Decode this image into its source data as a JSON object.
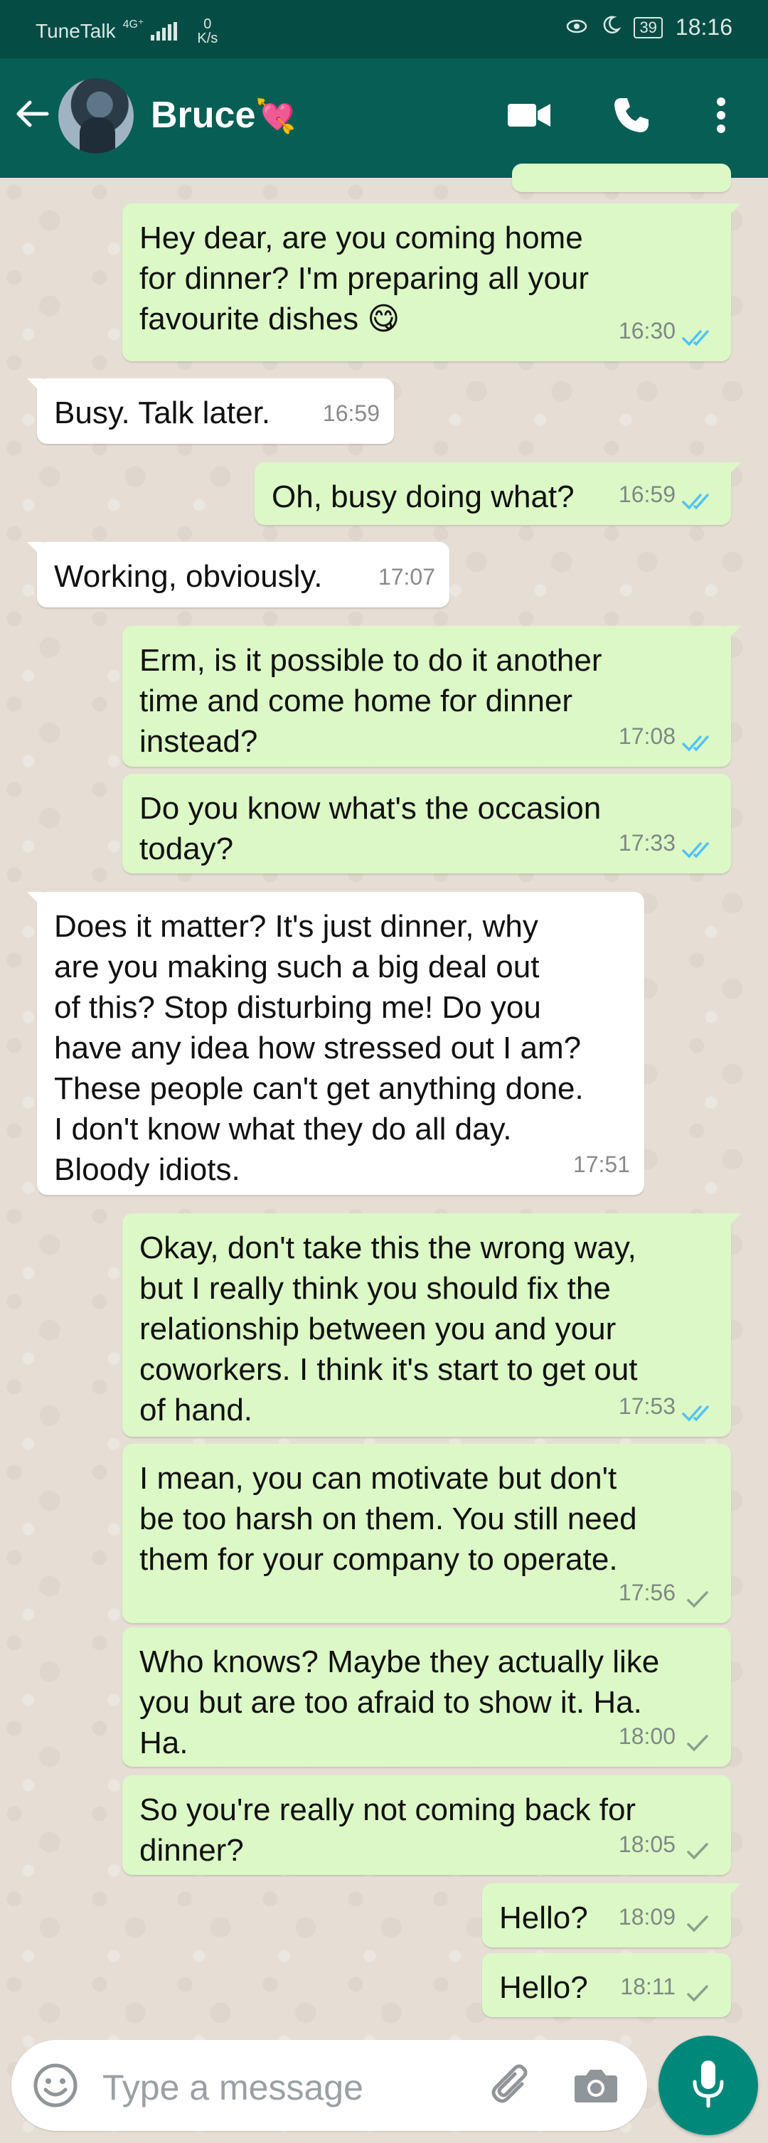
{
  "status_bar": {
    "carrier": "TuneTalk",
    "network": "4G⁺",
    "speed_value": "0",
    "speed_unit": "K/s",
    "battery": "39",
    "time": "18:16"
  },
  "header": {
    "contact_name": "Bruce",
    "name_emoji": "💘",
    "icons": [
      "back-arrow-icon",
      "video-call-icon",
      "voice-call-icon",
      "more-options-icon"
    ]
  },
  "messages": [
    {
      "dir": "out",
      "text": "Hey dear, are you coming home\nfor dinner? I'm preparing all your\nfavourite dishes 😋",
      "time": "16:30",
      "status": "read"
    },
    {
      "dir": "in",
      "text": "Busy. Talk later.",
      "time": "16:59"
    },
    {
      "dir": "out",
      "text": "Oh, busy doing what?",
      "time": "16:59",
      "status": "read"
    },
    {
      "dir": "in",
      "text": "Working, obviously.",
      "time": "17:07"
    },
    {
      "dir": "out",
      "text": "Erm, is it possible to do it another\ntime and come home for dinner\ninstead?",
      "time": "17:08",
      "status": "read"
    },
    {
      "dir": "out",
      "text": "Do you know what's the occasion\ntoday?",
      "time": "17:33",
      "status": "read"
    },
    {
      "dir": "in",
      "text": "Does it matter? It's just dinner, why\nare you making such a big deal out\nof this? Stop disturbing me! Do you\nhave any idea how stressed out I am?\nThese people can't get anything done.\nI don't know what they do all day.\nBloody idiots.",
      "time": "17:51"
    },
    {
      "dir": "out",
      "text": "Okay, don't take this the wrong way,\nbut I really think you should fix the\nrelationship between you and your\ncoworkers. I think it's start to get out\nof hand.",
      "time": "17:53",
      "status": "read"
    },
    {
      "dir": "out",
      "text": "I mean, you can motivate but don't\nbe too harsh on them. You still need\nthem for your company to operate.",
      "time": "17:56",
      "status": "sent"
    },
    {
      "dir": "out",
      "text": "Who knows? Maybe they actually like\nyou but are too afraid to show it. Ha.\nHa.",
      "time": "18:00",
      "status": "sent"
    },
    {
      "dir": "out",
      "text": "So you're really not coming back for\ndinner?",
      "time": "18:05",
      "status": "sent"
    },
    {
      "dir": "out",
      "text": "Hello?",
      "time": "18:09",
      "status": "sent"
    },
    {
      "dir": "out",
      "text": "Hello?",
      "time": "18:11",
      "status": "sent"
    }
  ],
  "composer": {
    "placeholder": "Type a message",
    "icons": [
      "emoji-icon",
      "attach-icon",
      "camera-icon",
      "mic-icon"
    ]
  },
  "colors": {
    "header": "#075e54",
    "status_bar": "#054d44",
    "outgoing_bubble": "#dcf8c6",
    "incoming_bubble": "#ffffff",
    "read_tick": "#4fc3f7",
    "sent_tick": "#8aa18d",
    "mic_button": "#00897b"
  }
}
